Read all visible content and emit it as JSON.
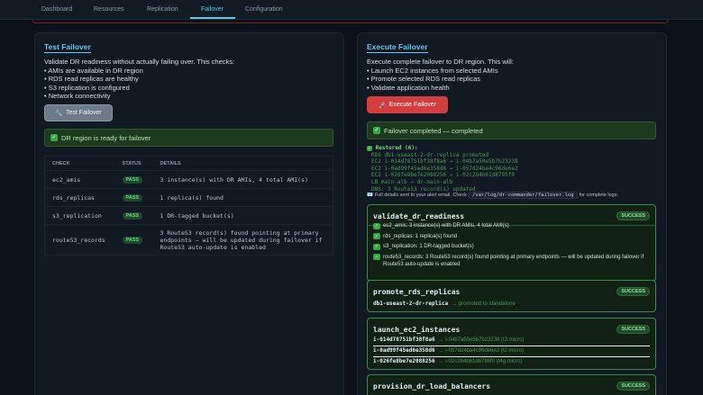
{
  "nav": {
    "tabs": [
      "Dashboard",
      "Resources",
      "Replication",
      "Failover",
      "Configuration"
    ],
    "active": "Failover"
  },
  "test": {
    "title": "Test Failover",
    "intro": "Validate DR readiness without actually failing over. This checks:",
    "bullets": [
      "AMIs are available in DR region",
      "RDS read replicas are healthy",
      "S3 replication is configured",
      "Network connectivity"
    ],
    "button": "Test Failover",
    "ready": "DR region is ready for failover",
    "columns": [
      "CHECK",
      "STATUS",
      "DETAILS"
    ],
    "rows": [
      {
        "check": "ec2_amis",
        "status": "PASS",
        "details": "3 instance(s) with DR AMIs, 4 total AMI(s)"
      },
      {
        "check": "rds_replicas",
        "status": "PASS",
        "details": "1 replica(s) found"
      },
      {
        "check": "s3_replication",
        "status": "PASS",
        "details": "1 DR-tagged bucket(s)"
      },
      {
        "check": "route53_records",
        "status": "PASS",
        "details": "3 Route53 record(s) found pointing at primary endpoints — will be updated during failover if Route53 auto-update is enabled"
      }
    ]
  },
  "execute": {
    "title": "Execute Failover",
    "intro": "Execute complete failover to DR region. This will:",
    "bullets": [
      "Launch EC2 instances from selected AMIs",
      "Promote selected RDS read replicas",
      "Validate application health"
    ],
    "button": "Execute Failover",
    "completed": "Failover completed — completed",
    "restored_head": "Restored (6):",
    "restored": [
      "RDS db1-useast-2-dr-replica promoted",
      "EC2 i-014d78751bf38f8a6 → i-04b7a50e5b7b23238",
      "EC2 i-0ad99f45ed6e358d6 → i-057d24ba4c96de6e2",
      "EC2 i-026fe8be7e2088256 → i-02c284b61d8795f0",
      "LB main-alb → dr-main-alb",
      "DNS: 3 Route53 record(s) updated"
    ],
    "log_prefix": "Full details sent to your alert email. Check",
    "log_path": "/var/log/dr-commander/failover.log",
    "log_suffix": "for complete logs.",
    "steps": [
      {
        "name": "validate_dr_readiness",
        "badge": "SUCCESS",
        "lines": [
          "ec2_amis: 3 instance(s) with DR AMIs, 4 total AMI(s)",
          "rds_replicas: 1 replica(s) found",
          "s3_replication: 1 DR-tagged bucket(s)",
          "route53_records: 3 Route53 record(s) found pointing at primary endpoints — will be updated during failover if Route53 auto-update is enabled"
        ]
      },
      {
        "name": "promote_rds_replicas",
        "badge": "SUCCESS",
        "replica": "db1-useast-2-dr-replica",
        "replica_note": "→ promoted to standalone"
      },
      {
        "name": "launch_ec2_instances",
        "badge": "SUCCESS",
        "instances": [
          {
            "id": "i-014d78751bf38f8a6",
            "to": "→ i-04b7a50e5b7b23238 (t2.micro)"
          },
          {
            "id": "i-0ad99f45ed6e358d6",
            "to": "→ i-057d24ba4c96de6e2 (t2.micro)"
          },
          {
            "id": "i-026fe8be7e2088256",
            "to": "→ i-02c284b61d8795f0 (t4g.micro)"
          }
        ]
      },
      {
        "name": "provision_dr_load_balancers",
        "badge": "SUCCESS"
      }
    ]
  }
}
